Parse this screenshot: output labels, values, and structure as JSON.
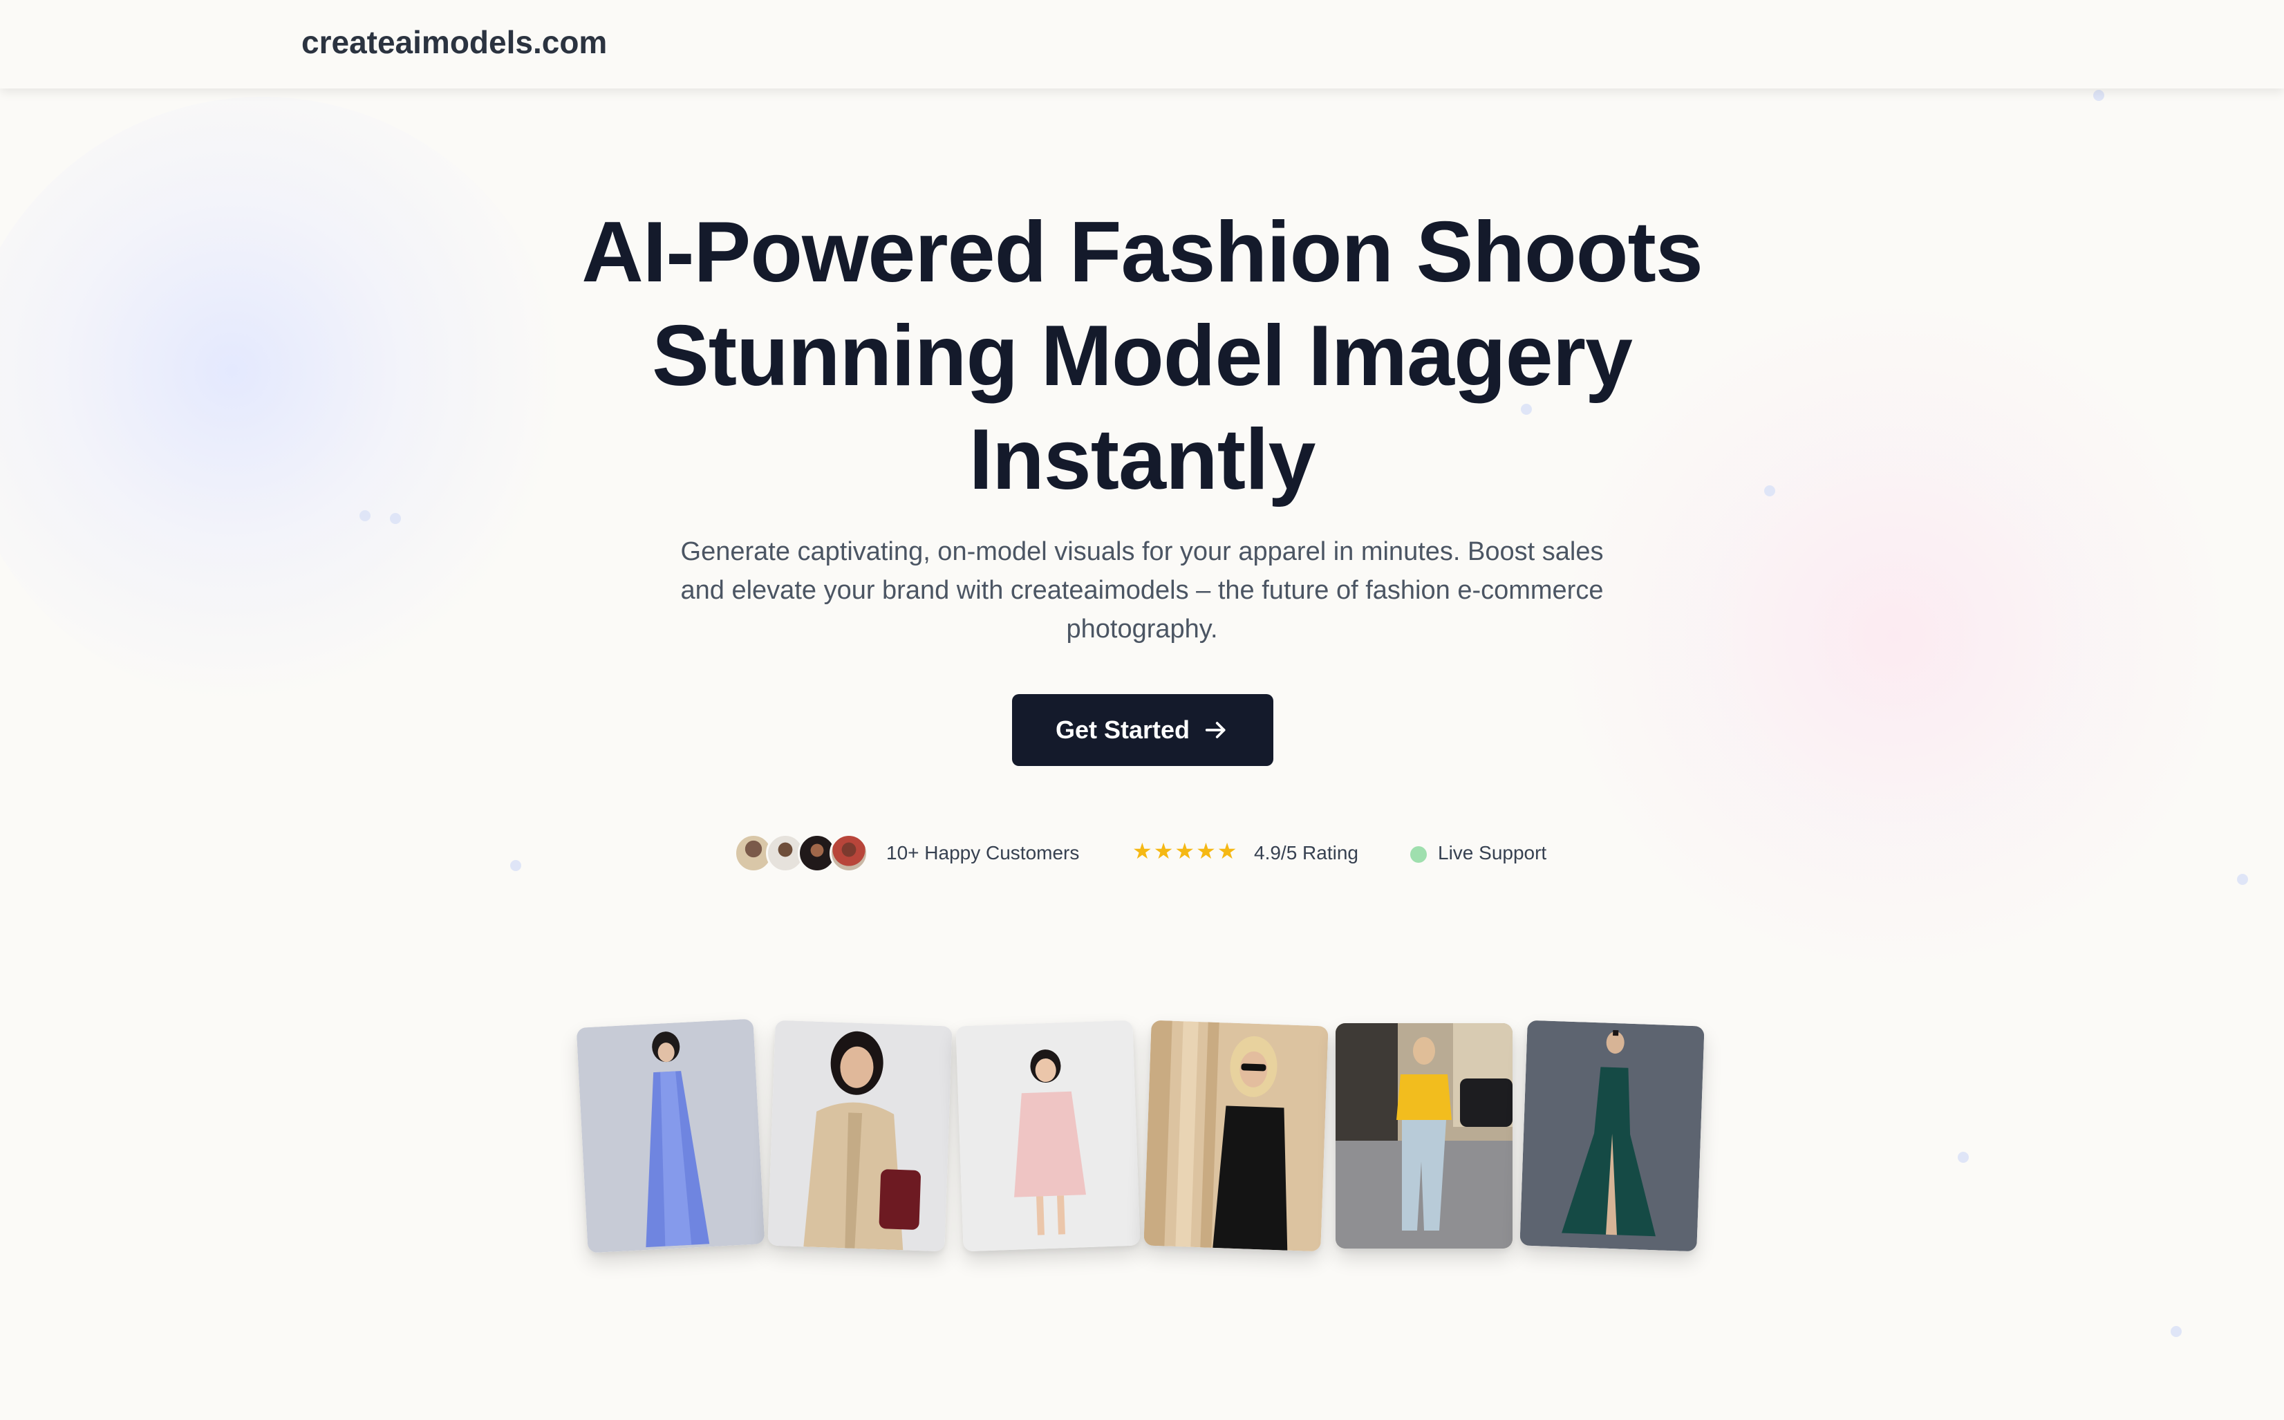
{
  "header": {
    "logo": "createaimodels.com"
  },
  "hero": {
    "title_line1": "AI-Powered Fashion Shoots",
    "title_line2": "Stunning Model Imagery",
    "title_line3": "Instantly",
    "subtitle": "Generate captivating, on-model visuals for your apparel in minutes. Boost sales and elevate your brand with createaimodels – the future of fashion e-commerce photography.",
    "cta_label": "Get Started",
    "cta_icon": "arrow-right-icon"
  },
  "trust": {
    "customers": "10+ Happy Customers",
    "rating_stars": "★★★★★",
    "rating": "4.9/5 Rating",
    "support": "Live Support",
    "support_color": "#9fdfae"
  },
  "gallery": {
    "cards": [
      {
        "alt": "model in blue satin slip dress"
      },
      {
        "alt": "model in beige trench coat with red bag"
      },
      {
        "alt": "girl in pink dress"
      },
      {
        "alt": "model in black one-shoulder top with sunglasses"
      },
      {
        "alt": "model in yellow blouse and jeans on street"
      },
      {
        "alt": "model in green satin gown"
      }
    ]
  },
  "colors": {
    "primary": "#141a2b",
    "background": "#fbfaf7",
    "star": "#f5b814"
  }
}
